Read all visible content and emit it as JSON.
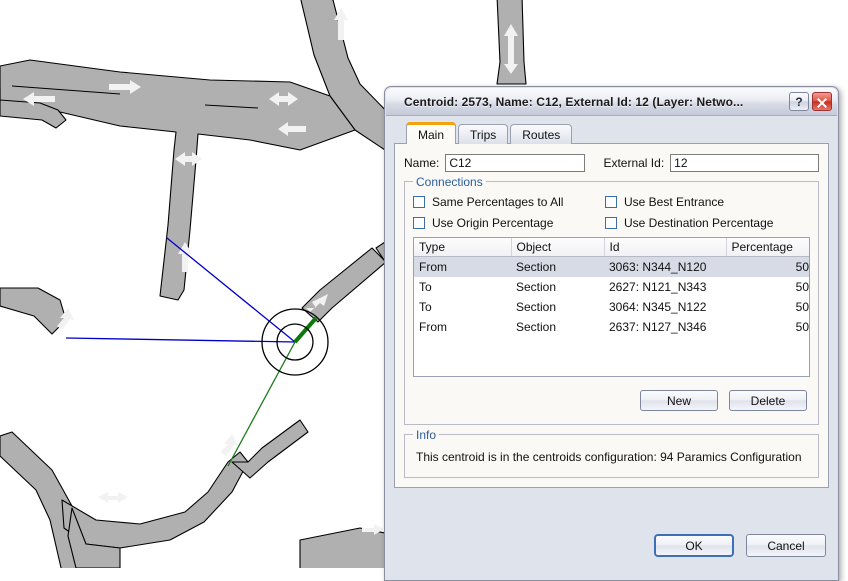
{
  "dialog": {
    "title": "Centroid: 2573, Name: C12, External Id: 12 (Layer: Netwo...",
    "help_button": "?",
    "close_button": "✕",
    "tabs": [
      {
        "label": "Main",
        "active": true
      },
      {
        "label": "Trips",
        "active": false
      },
      {
        "label": "Routes",
        "active": false
      }
    ],
    "main_tab": {
      "name_label": "Name:",
      "name_value": "C12",
      "external_id_label": "External Id:",
      "external_id_value": "12",
      "connections_group": {
        "legend": "Connections",
        "checkboxes": [
          {
            "label": "Same Percentages to All",
            "checked": false
          },
          {
            "label": "Use Best Entrance",
            "checked": false
          },
          {
            "label": "Use Origin Percentage",
            "checked": false
          },
          {
            "label": "Use Destination Percentage",
            "checked": false
          }
        ],
        "table": {
          "columns": [
            "Type",
            "Object",
            "Id",
            "Percentage"
          ],
          "rows": [
            {
              "type": "From",
              "object": "Section",
              "id": "3063: N344_N120",
              "percentage": "50",
              "selected": true
            },
            {
              "type": "To",
              "object": "Section",
              "id": "2627: N121_N343",
              "percentage": "50",
              "selected": false
            },
            {
              "type": "To",
              "object": "Section",
              "id": "3064: N345_N122",
              "percentage": "50",
              "selected": false
            },
            {
              "type": "From",
              "object": "Section",
              "id": "2637: N127_N346",
              "percentage": "50",
              "selected": false
            }
          ]
        },
        "new_button": "New",
        "delete_button": "Delete"
      },
      "info_group": {
        "legend": "Info",
        "text": "This centroid is in the centroids configuration: 94 Paramics Configuration"
      }
    },
    "footer": {
      "ok_button": "OK",
      "cancel_button": "Cancel"
    }
  },
  "map": {
    "road_fill": "#b0b0b0",
    "road_stroke": "#000000",
    "arrow_color": "#f2f2f2",
    "centroid_circle_color": "#000000",
    "from_connection_color": "#0000cc",
    "to_connection_color": "#1f7a1f",
    "background": "#ffffff"
  }
}
